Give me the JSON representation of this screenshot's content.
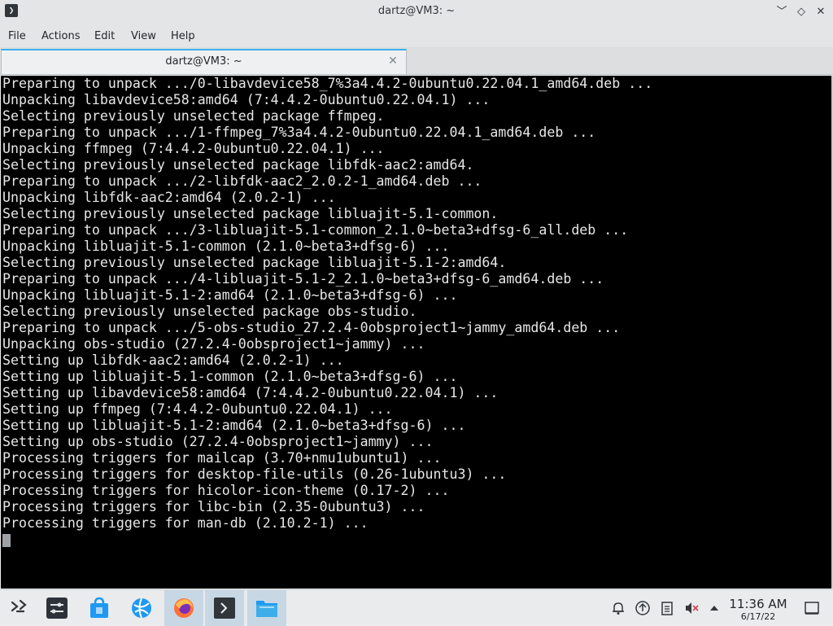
{
  "window": {
    "title": "dartz@VM3: ~",
    "app_icon_glyph": "❯",
    "controls": {
      "minimize": "﹀",
      "maximize": "◇",
      "close": "✕"
    }
  },
  "menu": [
    "File",
    "Actions",
    "Edit",
    "View",
    "Help"
  ],
  "tab": {
    "label": "dartz@VM3: ~",
    "close": "✕"
  },
  "terminal": {
    "background": "#000000",
    "foreground": "#e7e7e7",
    "lines": [
      "Preparing to unpack .../0-libavdevice58_7%3a4.4.2-0ubuntu0.22.04.1_amd64.deb ...",
      "Unpacking libavdevice58:amd64 (7:4.4.2-0ubuntu0.22.04.1) ...",
      "Selecting previously unselected package ffmpeg.",
      "Preparing to unpack .../1-ffmpeg_7%3a4.4.2-0ubuntu0.22.04.1_amd64.deb ...",
      "Unpacking ffmpeg (7:4.4.2-0ubuntu0.22.04.1) ...",
      "Selecting previously unselected package libfdk-aac2:amd64.",
      "Preparing to unpack .../2-libfdk-aac2_2.0.2-1_amd64.deb ...",
      "Unpacking libfdk-aac2:amd64 (2.0.2-1) ...",
      "Selecting previously unselected package libluajit-5.1-common.",
      "Preparing to unpack .../3-libluajit-5.1-common_2.1.0~beta3+dfsg-6_all.deb ...",
      "Unpacking libluajit-5.1-common (2.1.0~beta3+dfsg-6) ...",
      "Selecting previously unselected package libluajit-5.1-2:amd64.",
      "Preparing to unpack .../4-libluajit-5.1-2_2.1.0~beta3+dfsg-6_amd64.deb ...",
      "Unpacking libluajit-5.1-2:amd64 (2.1.0~beta3+dfsg-6) ...",
      "Selecting previously unselected package obs-studio.",
      "Preparing to unpack .../5-obs-studio_27.2.4-0obsproject1~jammy_amd64.deb ...",
      "Unpacking obs-studio (27.2.4-0obsproject1~jammy) ...",
      "Setting up libfdk-aac2:amd64 (2.0.2-1) ...",
      "Setting up libluajit-5.1-common (2.1.0~beta3+dfsg-6) ...",
      "Setting up libavdevice58:amd64 (7:4.4.2-0ubuntu0.22.04.1) ...",
      "Setting up ffmpeg (7:4.4.2-0ubuntu0.22.04.1) ...",
      "Setting up libluajit-5.1-2:amd64 (2.1.0~beta3+dfsg-6) ...",
      "Setting up obs-studio (27.2.4-0obsproject1~jammy) ...",
      "Processing triggers for mailcap (3.70+nmu1ubuntu1) ...",
      "Processing triggers for desktop-file-utils (0.26-1ubuntu3) ...",
      "Processing triggers for hicolor-icon-theme (0.17-2) ...",
      "Processing triggers for libc-bin (2.35-0ubuntu3) ...",
      "Processing triggers for man-db (2.10.2-1) ..."
    ]
  },
  "taskbar": {
    "apps": [
      {
        "name": "application-launcher-icon",
        "active": false
      },
      {
        "name": "system-settings-icon",
        "active": false
      },
      {
        "name": "discover-store-icon",
        "active": false
      },
      {
        "name": "network-browser-icon",
        "active": false
      },
      {
        "name": "firefox-icon",
        "active": true
      },
      {
        "name": "konsole-terminal-icon",
        "active": true
      },
      {
        "name": "file-manager-icon",
        "active": true
      }
    ],
    "tray": [
      "notifications-icon",
      "updates-icon",
      "clipboard-icon",
      "volume-muted-icon",
      "tray-expand-icon"
    ],
    "clock": {
      "time": "11:36 AM",
      "date": "6/17/22"
    },
    "show_desktop": "show-desktop-icon"
  }
}
